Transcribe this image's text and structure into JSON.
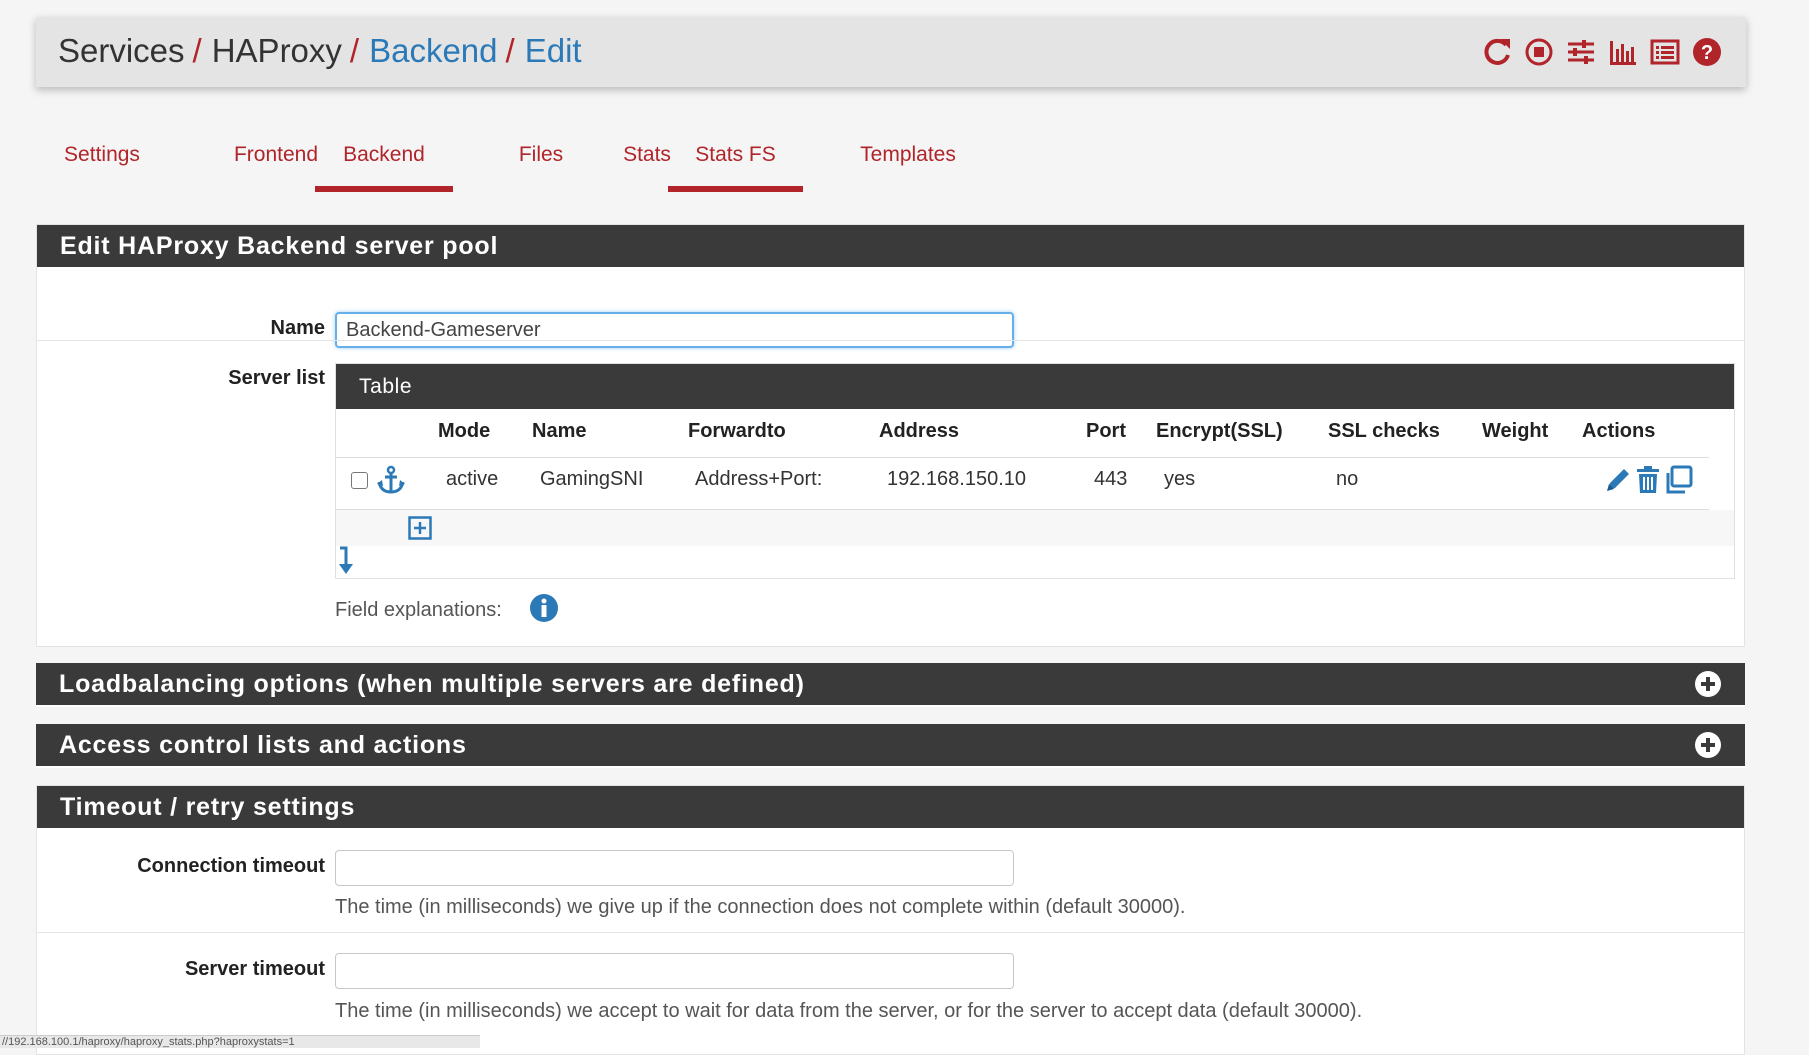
{
  "breadcrumb": {
    "items": [
      {
        "label": "Services",
        "link": false
      },
      {
        "label": "HAProxy",
        "link": false
      },
      {
        "label": "Backend",
        "link": true
      },
      {
        "label": "Edit",
        "link": true
      }
    ],
    "separator": "/"
  },
  "header_icons": [
    "reload-icon",
    "stop-circle-icon",
    "sliders-icon",
    "bar-chart-icon",
    "log-list-icon",
    "help-icon"
  ],
  "tabs": [
    {
      "label": "Settings",
      "active": false
    },
    {
      "label": "Frontend",
      "active": false
    },
    {
      "label": "Backend",
      "active": true
    },
    {
      "label": "Files",
      "active": false
    },
    {
      "label": "Stats",
      "active": false
    },
    {
      "label": "Stats FS",
      "active": true
    },
    {
      "label": "Templates",
      "active": false
    }
  ],
  "edit_panel": {
    "title": "Edit HAProxy Backend server pool",
    "name_label": "Name",
    "name_value": "Backend-Gameserver",
    "server_list_label": "Server list",
    "table_title": "Table",
    "columns": [
      "Mode",
      "Name",
      "Forwardto",
      "Address",
      "Port",
      "Encrypt(SSL)",
      "SSL checks",
      "Weight",
      "Actions"
    ],
    "rows": [
      {
        "mode": "active",
        "name": "GamingSNI",
        "forwardto": "Address+Port:",
        "address": "192.168.150.10",
        "port": "443",
        "encrypt": "yes",
        "ssl_checks": "no",
        "weight": ""
      }
    ],
    "field_explanations_label": "Field explanations:"
  },
  "loadbalancing_panel": {
    "title": "Loadbalancing options (when multiple servers are defined)"
  },
  "acl_panel": {
    "title": "Access control lists and actions"
  },
  "timeout_panel": {
    "title": "Timeout / retry settings",
    "connection_timeout_label": "Connection timeout",
    "connection_timeout_value": "",
    "connection_timeout_help": "The time (in milliseconds) we give up if the connection does not complete within (default 30000).",
    "server_timeout_label": "Server timeout",
    "server_timeout_value": "",
    "server_timeout_help": "The time (in milliseconds) we accept to wait for data from the server, or for the server to accept data (default 30000)."
  },
  "status_bar": {
    "url": "//192.168.100.1/haproxy/haproxy_stats.php?haproxystats=1"
  },
  "colors": {
    "accent_red": "#b0242a",
    "link_blue": "#2c79b8",
    "panel_dark": "#3a3a3a",
    "icon_blue": "#2c79b8"
  }
}
